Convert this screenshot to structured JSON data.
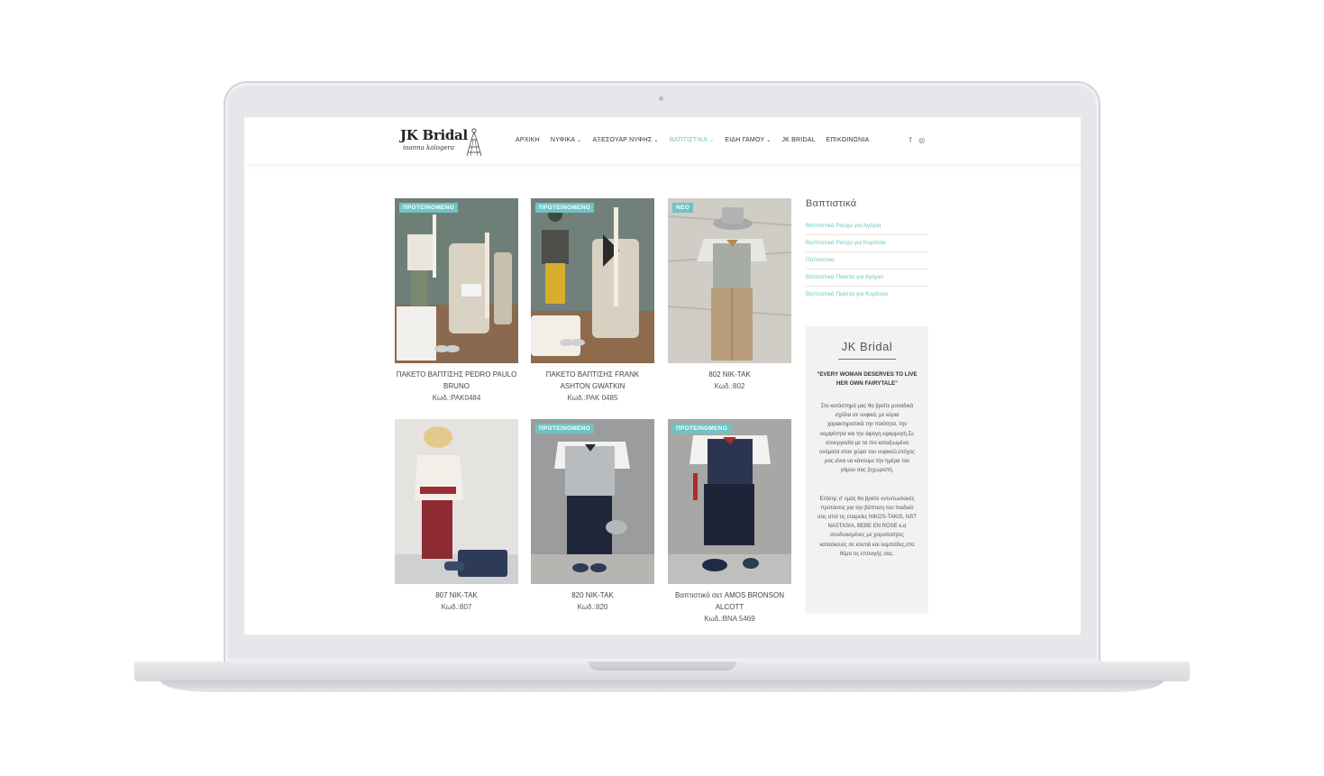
{
  "site": {
    "logo_text": "JK Bridal",
    "logo_sub": "ioanna kalogera"
  },
  "nav": {
    "items": [
      {
        "label": "ΑΡΧΙΚΗ",
        "dropdown": false,
        "active": false
      },
      {
        "label": "ΝΥΦΙΚΑ",
        "dropdown": true,
        "active": false
      },
      {
        "label": "ΑΞΕΣΟΥΑΡ ΝΥΦΗΣ",
        "dropdown": true,
        "active": false
      },
      {
        "label": "ΒΑΠΤΙΣΤΙΚΑ",
        "dropdown": true,
        "active": true
      },
      {
        "label": "ΕΙΔΗ ΓΑΜΟΥ",
        "dropdown": true,
        "active": false
      },
      {
        "label": "JK BRIDAL",
        "dropdown": false,
        "active": false
      },
      {
        "label": "ΕΠΙΚΟΙΝΩΝΙΑ",
        "dropdown": false,
        "active": false
      }
    ],
    "social": {
      "facebook": "f",
      "instagram": "◎"
    }
  },
  "products": [
    {
      "badge": "ΠΡΟΤΕΙΝΟΜΕΝΟ",
      "name": "ΠΑΚΕΤΟ ΒΑΠΤΙΣΗΣ PEDRO PAULO BRUNO",
      "code": "Κωδ.:PAK0484"
    },
    {
      "badge": "ΠΡΟΤΕΙΝΟΜΕΝΟ",
      "name": "ΠΑΚΕΤΟ ΒΑΠΤΙΣΗΣ FRANK ASHTON GWATKIN",
      "code": "Κωδ.:PAK 0485"
    },
    {
      "badge": "ΝΕΟ",
      "name": "802 NIK-TAK",
      "code": "Κωδ.:802"
    },
    {
      "badge": "",
      "name": "807 NIK-TAK",
      "code": "Κωδ.:807"
    },
    {
      "badge": "ΠΡΟΤΕΙΝΟΜΕΝΟ",
      "name": "820 NIK-TAK",
      "code": "Κωδ.:820"
    },
    {
      "badge": "ΠΡΟΤΕΙΝΟΜΕΝΟ",
      "name": "Βαπτιστικό σετ AMOS BRONSON ALCOTT",
      "code": "Κωδ.:BNA 5469"
    }
  ],
  "sidebar": {
    "title": "Βαπτιστικά",
    "links": [
      "Βαπτιστικά Ρούχα για Αγόρια",
      "Βαπτιστικά Ρούχα για Κορίτσια",
      "Παπούτσια",
      "Βαπτιστικά Πακέτα για Αγόρια",
      "Βαπτιστικά Πακέτα για Κορίτσια"
    ]
  },
  "about": {
    "title": "JK Bridal",
    "quote": "\"EVERY WOMAN DESERVES TO LIVE HER OWN FAIRYTALE\"",
    "p1": "Στο κατάστημά μας θα βρείτε μοναδικά σχέδια σε νυφικά, με κύρια χαρακτηριστικά την ποιότητα, την κομψότητα και την άψογη εφαρμογή.Σε συνεργασία με τα πιο καταξιωμένα ονόματα στον χώρο του νυφικού,στόχος μας είναι να κάνουμε την ημέρα του γάμου σας ξεχωριστή.",
    "p2": "Επίσης σ' εμάς θα βρείτε εντυπωσιακές προτάσεις για την βάπτιση του παιδιού σας από τις εταιρείες NIKOS-TAKIS, NST NASTASIA, BEBE EN ROSE κ.α συνδυασμένες με χειροποίητες κατασκευές σε κουτιά και λαμπάδες,στο θέμα τις επιλογής σας."
  },
  "colors": {
    "accent": "#6ec4c4",
    "frame": "#e6e7ea"
  }
}
